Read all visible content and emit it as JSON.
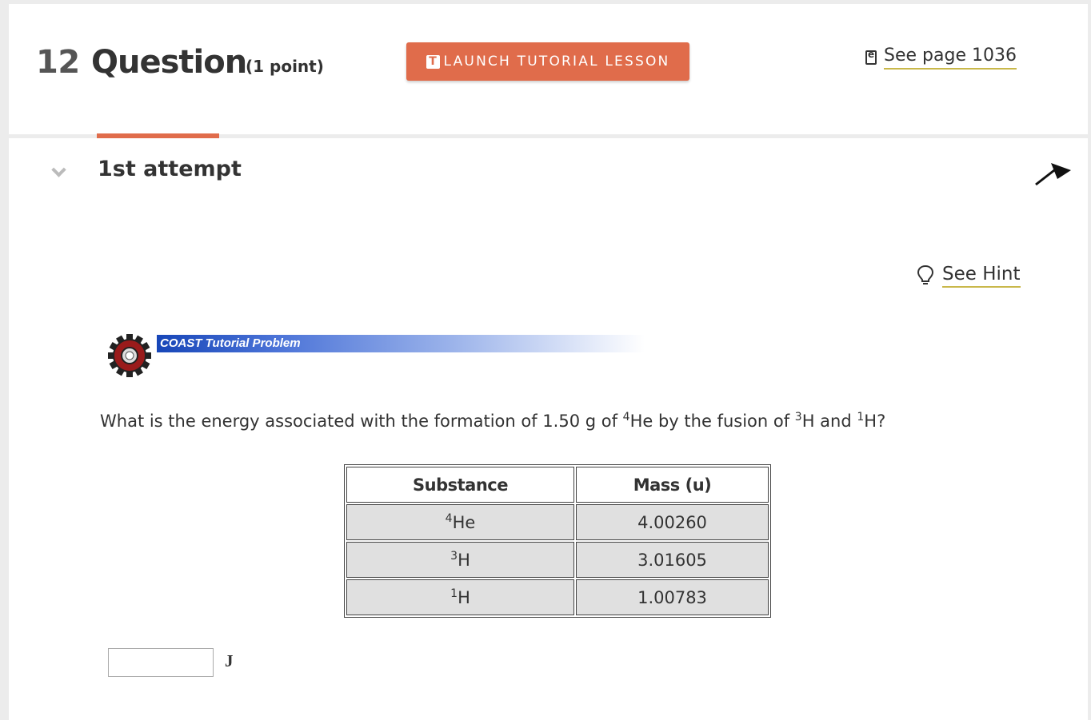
{
  "header": {
    "question_number": "12",
    "question_label": "Question",
    "points": "(1 point)",
    "launch_button_icon": "T",
    "launch_button_label": "LAUNCH TUTORIAL LESSON",
    "page_link_icon": "ebook-icon",
    "page_link_label": "See page 1036"
  },
  "attempt": {
    "title": "1st attempt",
    "chevron_icon": "chevron-down-icon",
    "corner_icon": "arrow-up-right-icon"
  },
  "hint": {
    "icon": "lightbulb-icon",
    "label": "See Hint"
  },
  "banner": {
    "icon": "gear-icon",
    "label": "COAST Tutorial Problem"
  },
  "question": {
    "part1": "What is the energy associated with the formation of 1.50 g of ",
    "sup1": "4",
    "part2": "He by the fusion of ",
    "sup2": "3",
    "part3": "H and ",
    "sup3": "1",
    "part4": "H?"
  },
  "table": {
    "headers": [
      "Substance",
      "Mass (u)"
    ],
    "rows": [
      {
        "sup": "4",
        "element": "He",
        "mass": "4.00260"
      },
      {
        "sup": "3",
        "element": "H",
        "mass": "3.01605"
      },
      {
        "sup": "1",
        "element": "H",
        "mass": "1.00783"
      }
    ]
  },
  "answer": {
    "value": "",
    "unit": "J"
  },
  "colors": {
    "accent": "#e06c4b",
    "link_underline": "#c9b84a",
    "banner_blue": "#1746b8"
  }
}
